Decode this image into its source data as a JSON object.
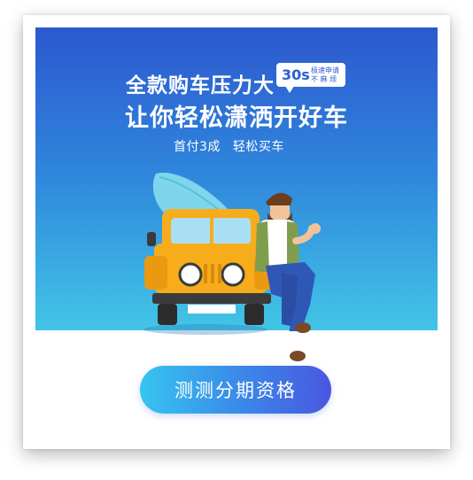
{
  "banner": {
    "headline": "全款购车压力大",
    "headline2": "让你轻松潇洒开好车",
    "badge": {
      "main": "30s",
      "sub_line1": "极速申请",
      "sub_line2": "不 麻 烦"
    },
    "sub_left": "首付3成",
    "sub_right": "轻松买车"
  },
  "cta": {
    "label": "测测分期资格"
  },
  "colors": {
    "banner_top": "#2d58cf",
    "banner_bottom": "#42c5e6",
    "car_yellow": "#f7ad1b",
    "button_left": "#37c4f0",
    "button_right": "#4a57e0"
  },
  "icons": [
    "surfboard-icon",
    "jeep-car-icon",
    "bearded-man-icon"
  ]
}
